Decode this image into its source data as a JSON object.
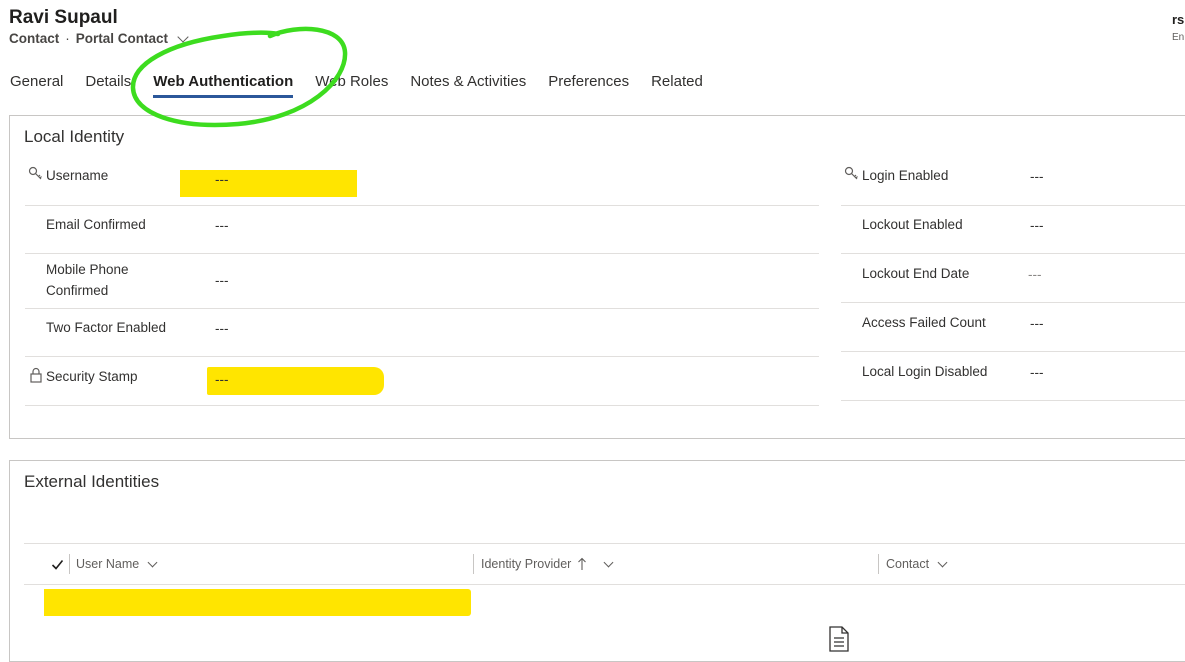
{
  "header": {
    "title": "Ravi Supaul",
    "entity": "Contact",
    "form_name": "Portal Contact",
    "right_text_1": "rs",
    "right_text_2": "En"
  },
  "tabs": [
    {
      "label": "General"
    },
    {
      "label": "Details"
    },
    {
      "label": "Web Authentication",
      "active": true
    },
    {
      "label": "Web Roles"
    },
    {
      "label": "Notes & Activities"
    },
    {
      "label": "Preferences"
    },
    {
      "label": "Related"
    }
  ],
  "local_identity": {
    "title": "Local Identity",
    "left_fields": [
      {
        "label": "Username",
        "value": "---",
        "icon": "key-icon",
        "highlighted": true
      },
      {
        "label": "Email Confirmed",
        "value": "---"
      },
      {
        "label_line1": "Mobile Phone",
        "label_line2": "Confirmed",
        "value": "---"
      },
      {
        "label": "Two Factor Enabled",
        "value": "---"
      },
      {
        "label": "Security Stamp",
        "value": "---",
        "icon": "lock-icon",
        "highlighted": true
      }
    ],
    "right_fields": [
      {
        "label": "Login Enabled",
        "value": "---",
        "icon": "key-icon"
      },
      {
        "label": "Lockout Enabled",
        "value": "---"
      },
      {
        "label": "Lockout End Date",
        "value": "---"
      },
      {
        "label": "Access Failed Count",
        "value": "---"
      },
      {
        "label": "Local Login Disabled",
        "value": "---"
      }
    ]
  },
  "external_identities": {
    "title": "External Identities",
    "columns": [
      {
        "label": "User Name"
      },
      {
        "label": "Identity Provider",
        "sort": "ascending"
      },
      {
        "label": "Contact"
      }
    ]
  },
  "colors": {
    "highlight": "#ffe500",
    "annotation_circle": "#3ddc1f",
    "tab_underline": "#2b579a"
  }
}
